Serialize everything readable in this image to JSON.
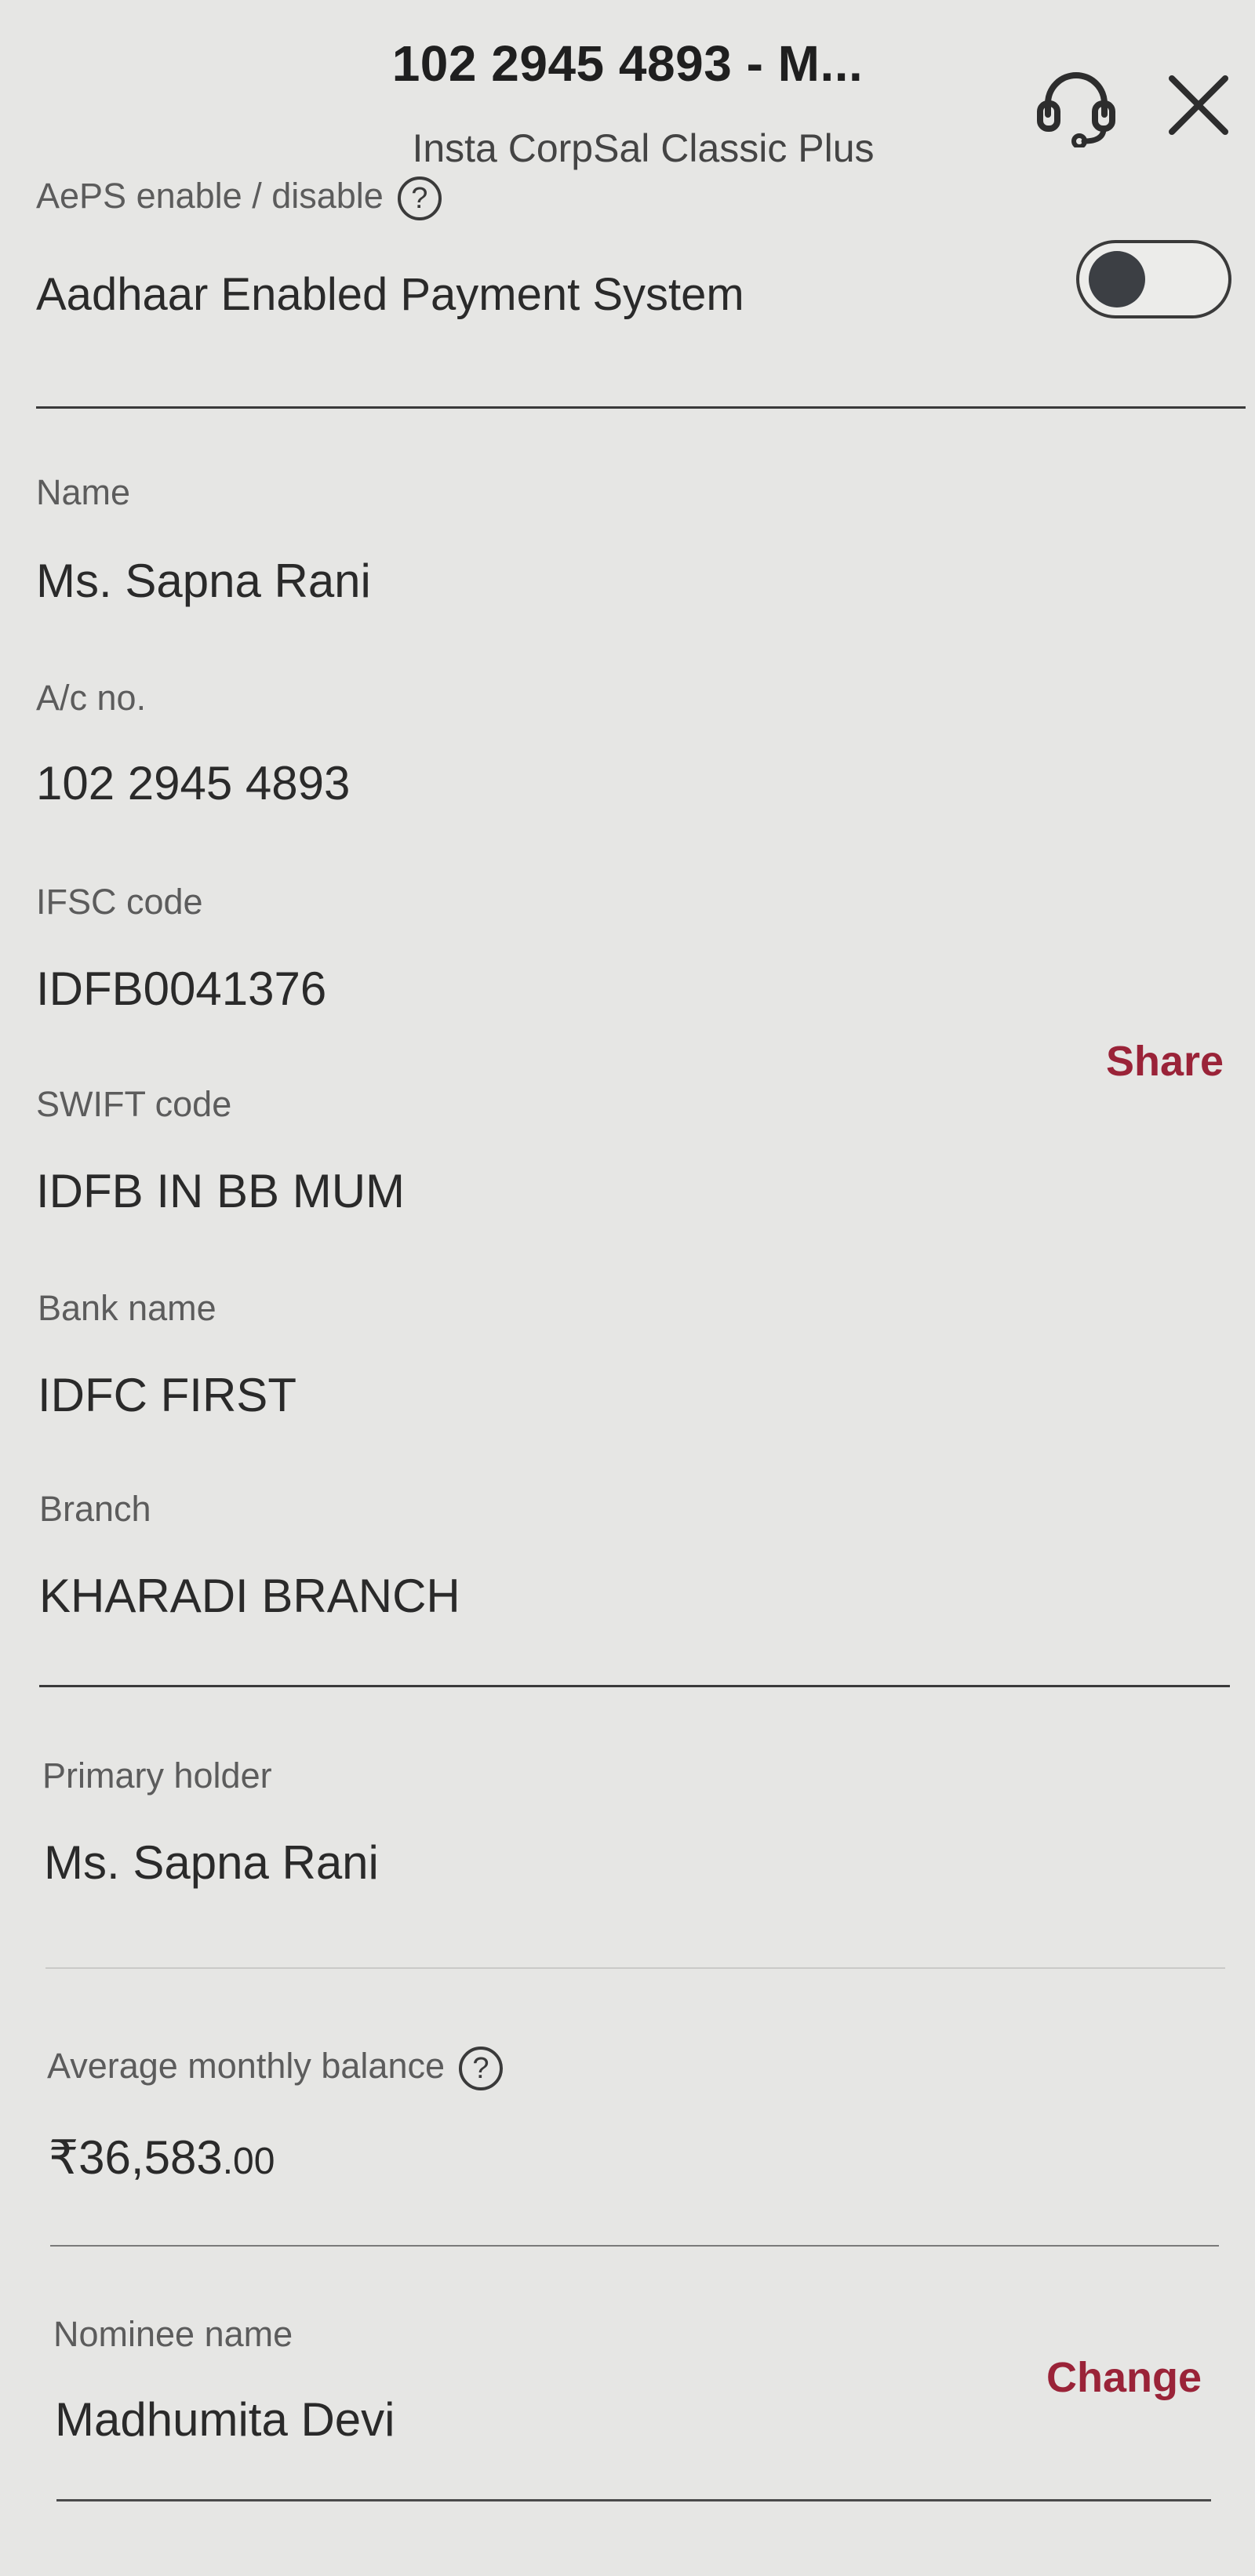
{
  "header": {
    "title": "102 2945 4893 - M...",
    "subtitle": "Insta CorpSal Classic Plus"
  },
  "aeps": {
    "label": "AePS enable / disable",
    "help": "?",
    "description": "Aadhaar Enabled Payment System",
    "toggle_on": false
  },
  "details": {
    "name_label": "Name",
    "name_value": "Ms. Sapna  Rani",
    "acc_label": "A/c no.",
    "acc_value": "102 2945 4893",
    "ifsc_label": "IFSC code",
    "ifsc_value": "IDFB0041376",
    "share_label": "Share",
    "swift_label": "SWIFT code",
    "swift_value": "IDFB IN BB MUM",
    "bank_label": "Bank name",
    "bank_value": "IDFC FIRST",
    "branch_label": "Branch",
    "branch_value": "KHARADI BRANCH"
  },
  "holder": {
    "label": "Primary holder",
    "value": "Ms. Sapna  Rani"
  },
  "balance": {
    "label": "Average monthly balance",
    "help": "?",
    "value_main": "₹36,583",
    "value_decimal": ".00"
  },
  "nominee": {
    "label": "Nominee name",
    "value": "Madhumita Devi",
    "change_label": "Change"
  },
  "colors": {
    "accent": "#9a2338",
    "background": "#e6e6e4"
  },
  "icons": {
    "support": "headset-icon",
    "close": "close-icon",
    "help": "question-circle-icon"
  }
}
